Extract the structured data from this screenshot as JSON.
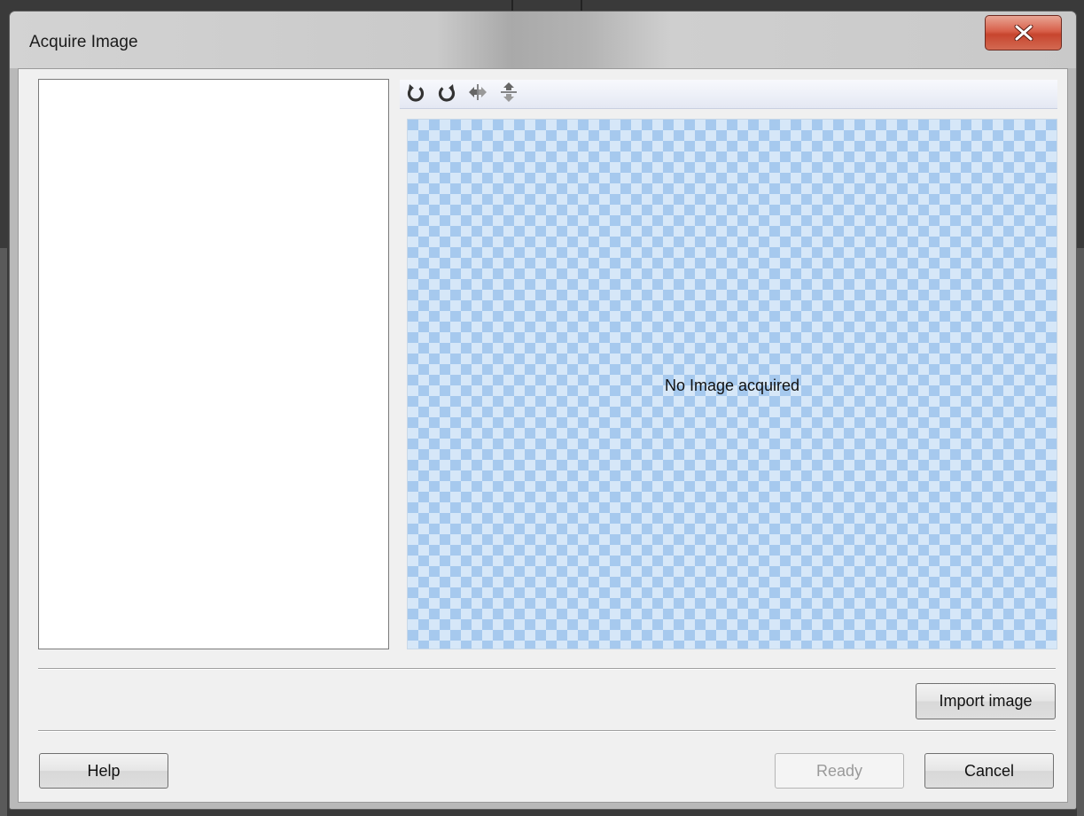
{
  "window": {
    "title": "Acquire Image",
    "close_icon": "close-x-icon"
  },
  "toolbar": {
    "tools": [
      {
        "name": "rotate-left-icon"
      },
      {
        "name": "rotate-right-icon"
      },
      {
        "name": "flip-horizontal-icon"
      },
      {
        "name": "flip-vertical-icon"
      }
    ]
  },
  "preview": {
    "message": "No Image acquired"
  },
  "buttons": {
    "import": "Import image",
    "help": "Help",
    "ready": "Ready",
    "cancel": "Cancel"
  },
  "colors": {
    "close_button": "#c7452e",
    "checker_dark": "#a6c9ee",
    "checker_light": "#d6e7f8"
  }
}
